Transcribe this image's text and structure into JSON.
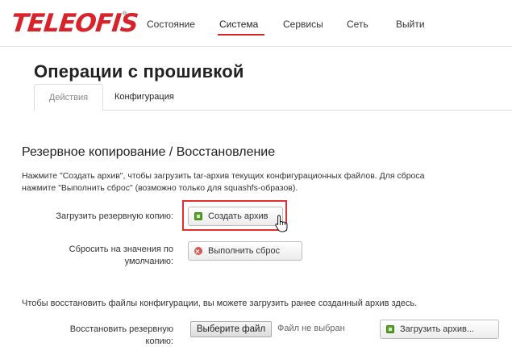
{
  "brand": {
    "logo_text": "TELEOFIS",
    "reg_mark": "®",
    "accent_color": "#d8232a"
  },
  "nav": {
    "items": [
      {
        "label": "Состояние"
      },
      {
        "label": "Система"
      },
      {
        "label": "Сервисы"
      },
      {
        "label": "Сеть"
      },
      {
        "label": "Выйти"
      }
    ],
    "active_index": 1
  },
  "page": {
    "title": "Операции с прошивкой"
  },
  "tabs": [
    {
      "label": "Действия",
      "active": true
    },
    {
      "label": "Конфигурация",
      "active": false
    }
  ],
  "backup": {
    "title": "Резервное копирование / Восстановление",
    "desc_line1": "Нажмите \"Создать архив\", чтобы загрузить tar-архив текущих конфигурационных файлов. Для сброса",
    "desc_line2": "нажмите \"Выполнить сброс\" (возможно только для squashfs-образов).",
    "download_label": "Загрузить резервную копию:",
    "create_archive_button": "Создать архив",
    "reset_label_line1": "Сбросить на значения по",
    "reset_label_line2": "умолчанию:",
    "reset_button": "Выполнить сброс",
    "restore_desc": "Чтобы восстановить файлы конфигурации, вы можете загрузить ранее созданный архив здесь.",
    "restore_label_line1": "Восстановить резервную",
    "restore_label_line2": "копию:",
    "choose_file_button": "Выберите файл",
    "file_status": "Файл не выбран",
    "upload_archive_button": "Загрузить архив..."
  },
  "icons": {
    "create_archive": "download-arrow-icon",
    "reset": "reset-error-icon",
    "upload": "upload-arrow-icon",
    "cursor": "hand-pointer-icon"
  }
}
